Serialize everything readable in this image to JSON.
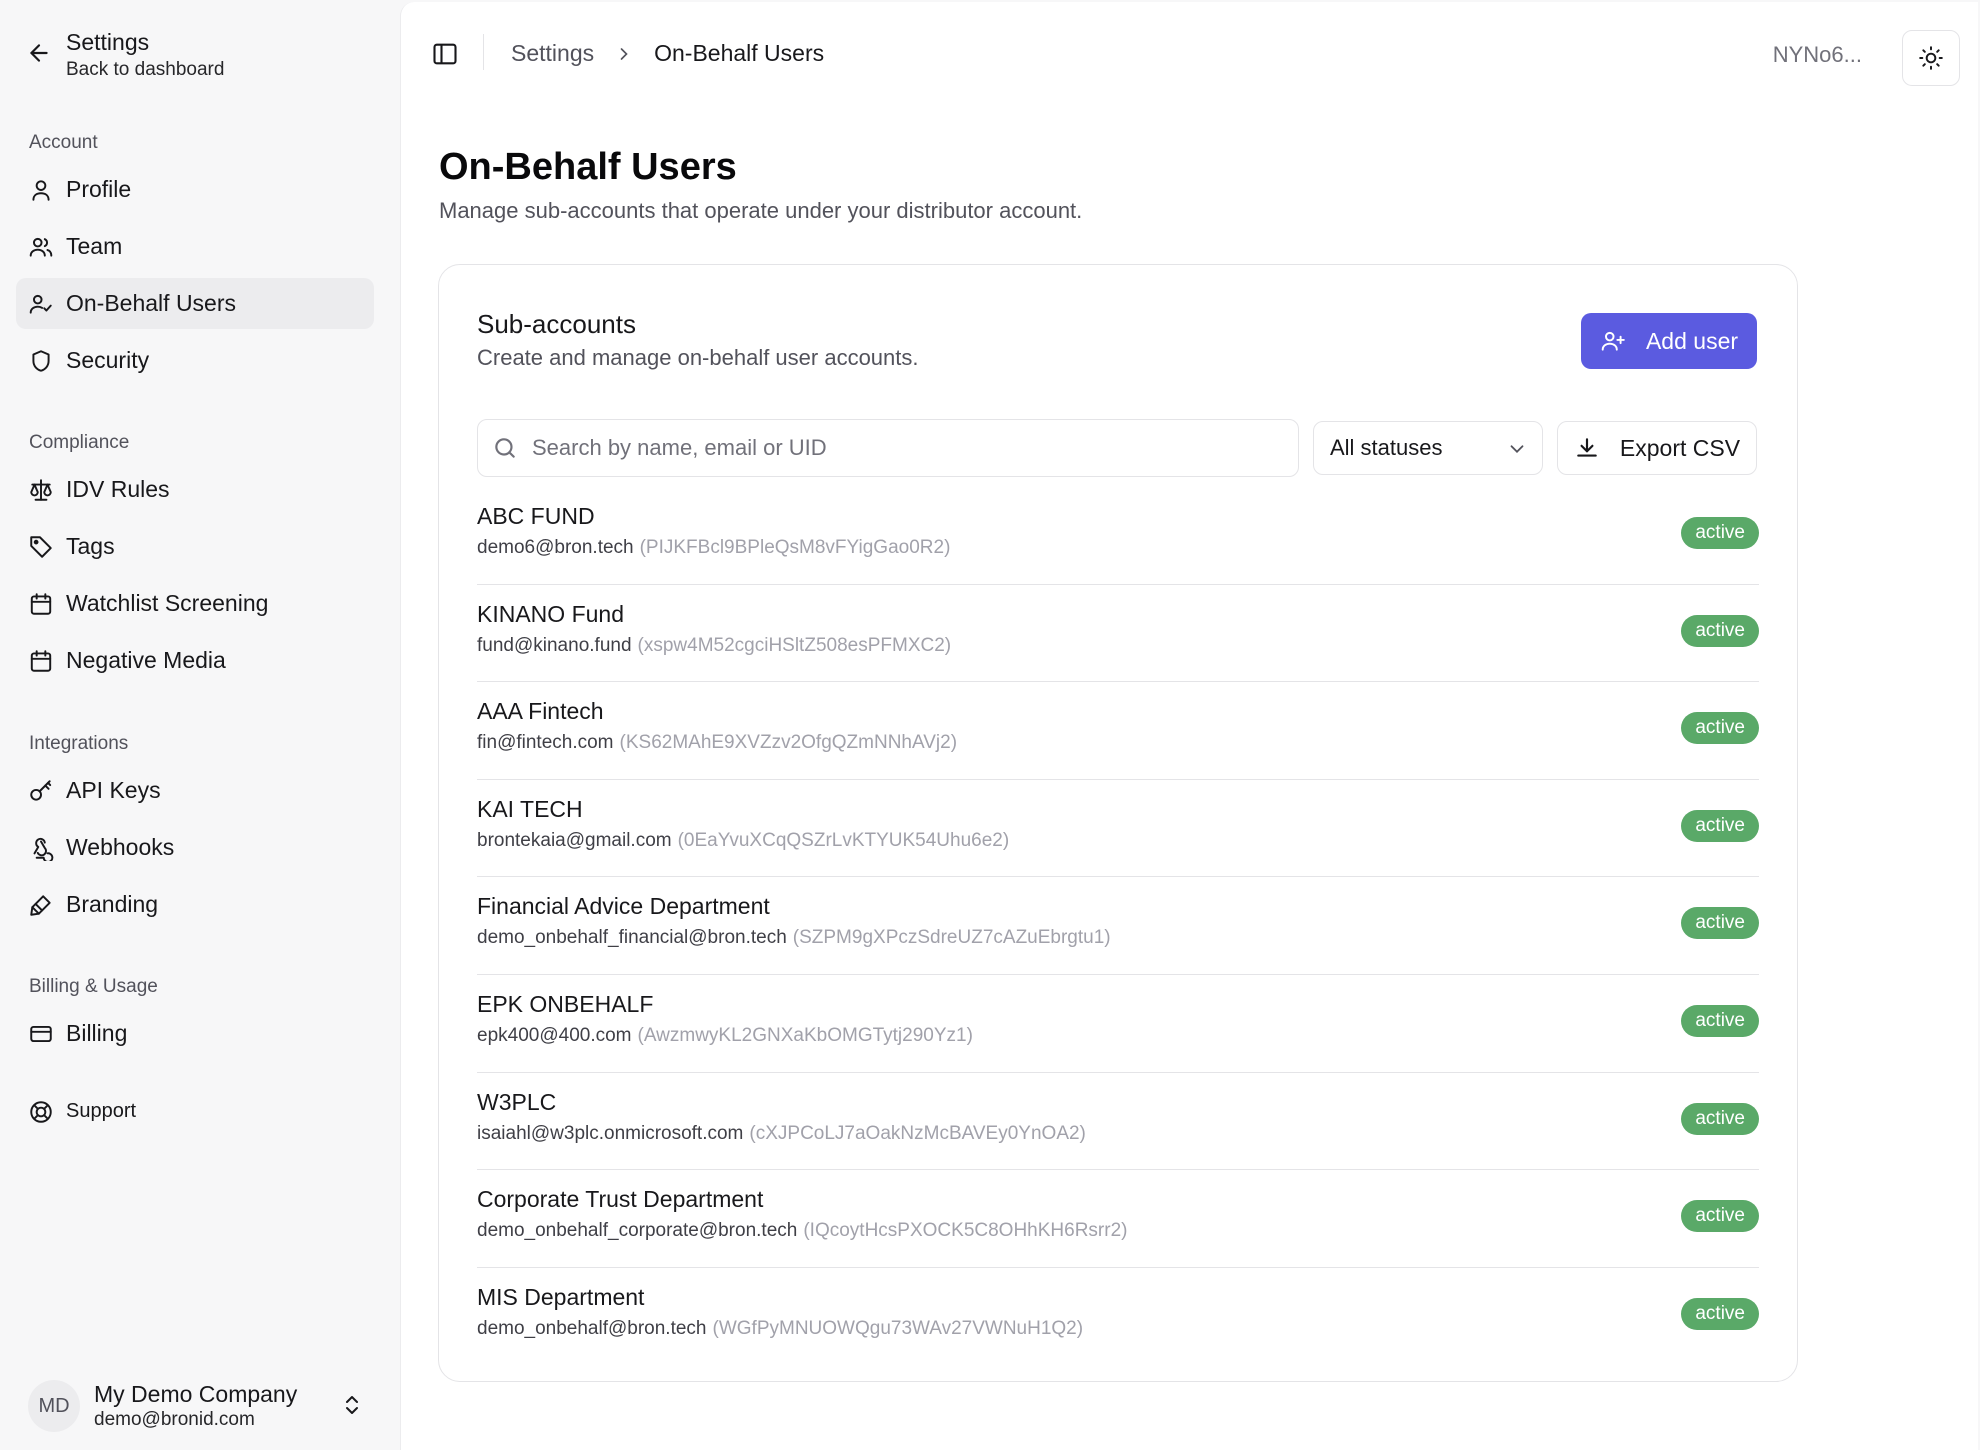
{
  "sidebar": {
    "title": "Settings",
    "subtitle": "Back to dashboard",
    "sections": [
      {
        "label": "Account",
        "items": [
          "Profile",
          "Team",
          "On-Behalf Users",
          "Security"
        ]
      },
      {
        "label": "Compliance",
        "items": [
          "IDV Rules",
          "Tags",
          "Watchlist Screening",
          "Negative Media"
        ]
      },
      {
        "label": "Integrations",
        "items": [
          "API Keys",
          "Webhooks",
          "Branding"
        ]
      },
      {
        "label": "Billing & Usage",
        "items": [
          "Billing"
        ]
      }
    ],
    "support_label": "Support",
    "footer": {
      "initials": "MD",
      "org_name": "My Demo Company",
      "email": "demo@bronid.com"
    }
  },
  "topbar": {
    "breadcrumb_parent": "Settings",
    "breadcrumb_current": "On-Behalf Users",
    "user_short": "NYNo6..."
  },
  "page": {
    "title": "On-Behalf Users",
    "description": "Manage sub-accounts that operate under your distributor account."
  },
  "card": {
    "title": "Sub-accounts",
    "description": "Create and manage on-behalf user accounts.",
    "add_label": "Add user",
    "search_placeholder": "Search by name, email or UID",
    "status_filter": "All statuses",
    "export_label": "Export CSV"
  },
  "users": [
    {
      "name": "ABC FUND",
      "email": "demo6@bron.tech",
      "uid": "(PIJKFBcl9BPleQsM8vFYigGao0R2)",
      "status": "active"
    },
    {
      "name": "KINANO Fund",
      "email": "fund@kinano.fund",
      "uid": "(xspw4M52cgciHSltZ508esPFMXC2)",
      "status": "active"
    },
    {
      "name": "AAA Fintech",
      "email": "fin@fintech.com",
      "uid": "(KS62MAhE9XVZzv2OfgQZmNNhAVj2)",
      "status": "active"
    },
    {
      "name": "KAI TECH",
      "email": "brontekaia@gmail.com",
      "uid": "(0EaYvuXCqQSZrLvKTYUK54Uhu6e2)",
      "status": "active"
    },
    {
      "name": "Financial Advice Department",
      "email": "demo_onbehalf_financial@bron.tech",
      "uid": "(SZPM9gXPczSdreUZ7cAZuEbrgtu1)",
      "status": "active"
    },
    {
      "name": "EPK ONBEHALF",
      "email": "epk400@400.com",
      "uid": "(AwzmwyKL2GNXaKbOMGTytj290Yz1)",
      "status": "active"
    },
    {
      "name": "W3PLC",
      "email": "isaiahl@w3plc.onmicrosoft.com",
      "uid": "(cXJPCoLJ7aOakNzMcBAVEy0YnOA2)",
      "status": "active"
    },
    {
      "name": "Corporate Trust Department",
      "email": "demo_onbehalf_corporate@bron.tech",
      "uid": "(IQcoytHcsPXOCK5C8OHhKH6Rsrr2)",
      "status": "active"
    },
    {
      "name": "MIS Department",
      "email": "demo_onbehalf@bron.tech",
      "uid": "(WGfPyMNUOWQgu73WAv27VWNuH1Q2)",
      "status": "active"
    }
  ],
  "colors": {
    "accent": "#5b5be0",
    "active_badge": "#5aa968"
  }
}
